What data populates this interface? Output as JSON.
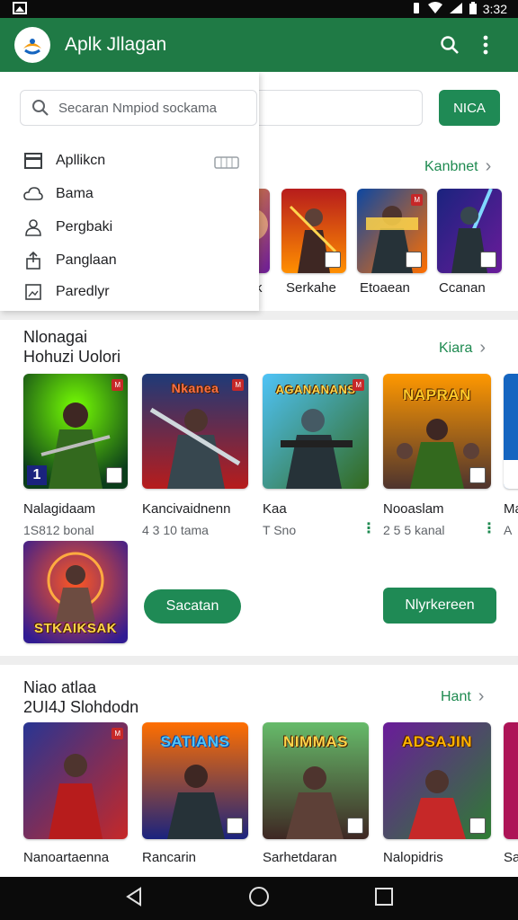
{
  "status_bar": {
    "time": "3:32"
  },
  "app_bar": {
    "title": "Aplk Jllagan"
  },
  "search": {
    "placeholder": "Secaran Nmpiod sockama",
    "button_label": "NICA"
  },
  "drawer": {
    "items": [
      {
        "label": "Apllikcn",
        "icon": "store-icon"
      },
      {
        "label": "Bama",
        "icon": "cloud-icon"
      },
      {
        "label": "Pergbaki",
        "icon": "person-icon"
      },
      {
        "label": "Panglaan",
        "icon": "share-icon"
      },
      {
        "label": "Paredlyr",
        "icon": "image-icon"
      }
    ]
  },
  "section1": {
    "more_label": "Kanbnet",
    "items": [
      {
        "label": "k"
      },
      {
        "label": "Serkahe"
      },
      {
        "label": "Etoaean"
      },
      {
        "label": "Ccanan"
      }
    ]
  },
  "section2": {
    "title_line1": "Nlonagai",
    "title_line2": "Hohuzi Uolori",
    "more_label": "Kiara",
    "items": [
      {
        "name": "Nalagidaam",
        "sub": "1S812 bonal",
        "badge": "1",
        "caption": ""
      },
      {
        "name": "Kancivaidnenn",
        "sub": "4 3 10 tama",
        "caption": "Nkanea"
      },
      {
        "name": "Kaa",
        "sub": "T Sno",
        "caption": "AGANANANS"
      },
      {
        "name": "Nooaslam",
        "sub": "2 5 5 kanal",
        "caption": "NAPRAN"
      },
      {
        "name": "Ma",
        "sub": "A"
      }
    ],
    "extra_tile_caption": "STKAIKSAK",
    "pill_label": "Sacatan",
    "right_button_label": "Nlyrkereen"
  },
  "section3": {
    "title_line1": "Niao atlaa",
    "title_line2": "2UI4J Slohdodn",
    "more_label": "Hant",
    "items": [
      {
        "name": "Nanoartaenna",
        "caption": ""
      },
      {
        "name": "Rancarin",
        "caption": "SATIANS"
      },
      {
        "name": "Sarhetdaran",
        "caption": "NIMMAS"
      },
      {
        "name": "Nalopidris",
        "caption": "ADSAJIN"
      },
      {
        "name": "Sa"
      }
    ]
  },
  "colors": {
    "primary": "#1f7a45",
    "accent": "#1f8a55"
  }
}
